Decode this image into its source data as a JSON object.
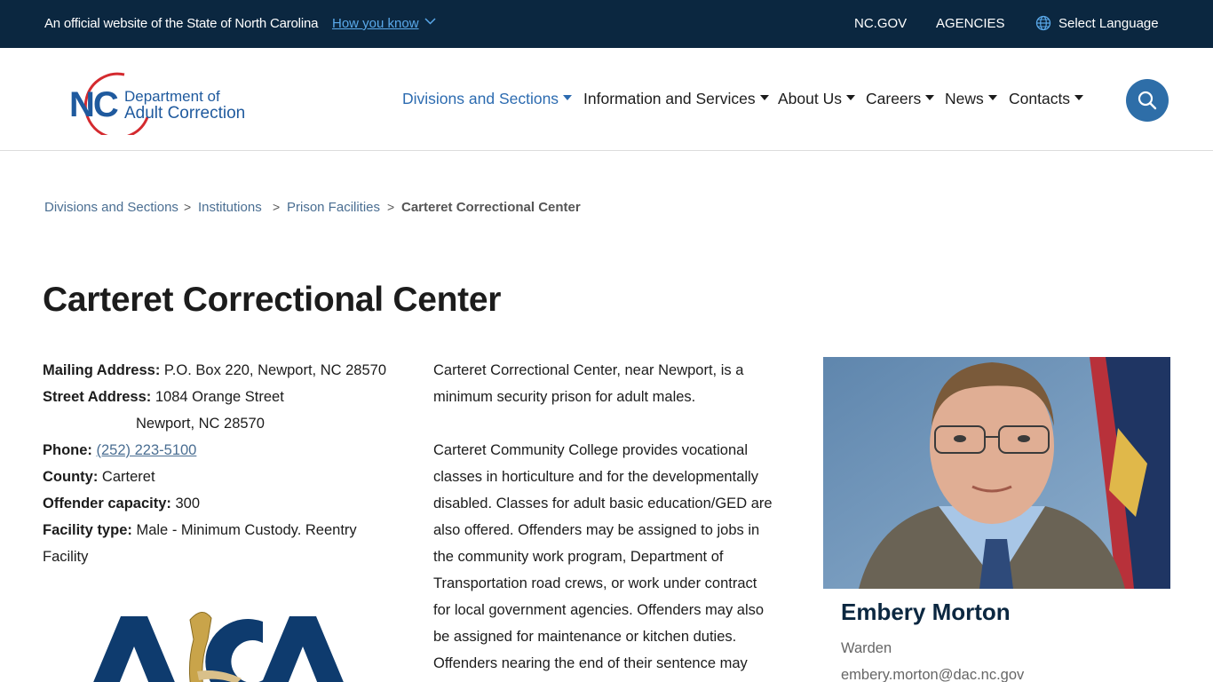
{
  "topbar": {
    "official_text": "An official website of the State of North Carolina",
    "how_you_know": "How you know",
    "links": [
      "NC.GOV",
      "AGENCIES"
    ],
    "language": "Select Language"
  },
  "header": {
    "logo": {
      "abbr": "NC",
      "line1": "Department of",
      "line2": "Adult Correction"
    },
    "nav": [
      {
        "label": "Divisions and Sections",
        "active": true
      },
      {
        "label": "Information and Services"
      },
      {
        "label": "About Us"
      },
      {
        "label": "Careers"
      },
      {
        "label": "News"
      },
      {
        "label": "Contacts"
      }
    ]
  },
  "breadcrumb": [
    "Divisions and Sections",
    "Institutions",
    "Prison Facilities",
    "Carteret Correctional Center"
  ],
  "page_title": "Carteret Correctional Center",
  "facility": {
    "mailing_label": "Mailing Address:",
    "mailing_value": "P.O. Box 220, Newport, NC 28570",
    "street_label": "Street Address:",
    "street_line1": "1084 Orange Street",
    "street_line2": "Newport, NC 28570",
    "phone_label": "Phone:",
    "phone_value": "(252) 223-5100",
    "county_label": "County:",
    "county_value": "Carteret",
    "capacity_label": "Offender capacity:",
    "capacity_value": "300",
    "type_label": "Facility type:",
    "type_value_1": "Male - Minimum Custody. Reentry",
    "type_value_2": "Facility"
  },
  "description": {
    "p1_lines": [
      "Carteret Correctional Center, near Newport, is a",
      "minimum security prison for adult males."
    ],
    "p2_lines": [
      "Carteret Community College provides vocational",
      "classes in horticulture and for the developmentally",
      "disabled. Classes for adult basic education/GED are",
      "also offered. Offenders may be assigned to jobs in",
      "the community work program, Department of",
      "Transportation road crews, or work under contract",
      "for local government agencies. Offenders may also",
      "be assigned for maintenance or kitchen duties.",
      "Offenders nearing the end of their sentence may"
    ]
  },
  "warden": {
    "name": "Embery Morton",
    "title": "Warden",
    "email": "embery.morton@dac.nc.gov"
  },
  "colors": {
    "topbar_bg": "#0b2740",
    "accent_blue": "#2c6bb0",
    "link": "#4a6e92",
    "logo_red": "#d42a2f"
  }
}
